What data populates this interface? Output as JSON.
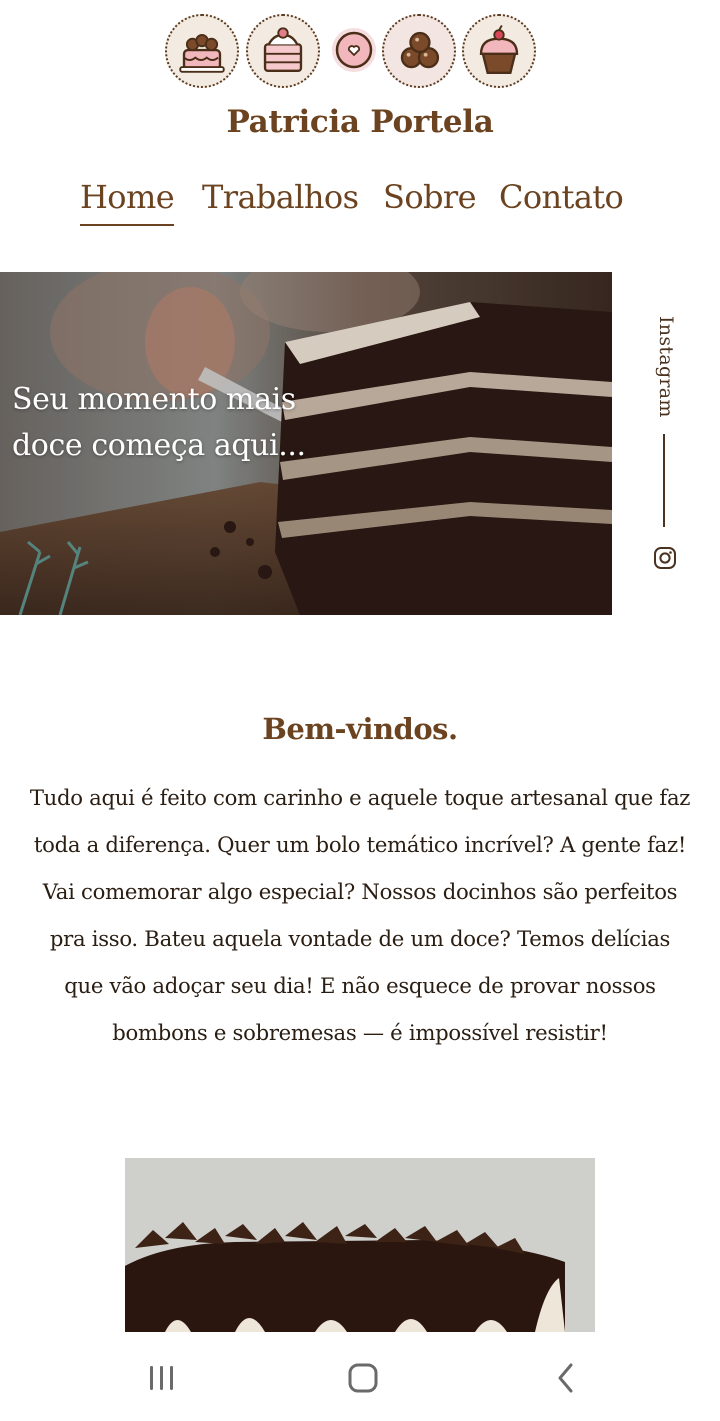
{
  "brand": {
    "name": "Patricia Portela"
  },
  "logo_badges": [
    {
      "icon": "layer-cake-icon"
    },
    {
      "icon": "cake-slice-icon"
    },
    {
      "icon": "donut-icon"
    },
    {
      "icon": "truffles-icon"
    },
    {
      "icon": "cupcake-icon"
    }
  ],
  "nav": {
    "items": [
      {
        "label": "Home",
        "active": true
      },
      {
        "label": "Trabalhos"
      },
      {
        "label": "Sobre"
      },
      {
        "label": "Contato"
      }
    ]
  },
  "hero": {
    "headline": "Seu momento mais doce começa aqui..."
  },
  "social": {
    "label": "Instagram",
    "icon": "instagram-icon"
  },
  "welcome": {
    "title": "Bem-vindos.",
    "body": "Tudo aqui é feito com carinho e aquele toque artesanal que faz toda a diferença. Quer um bolo temático incrível? A gente faz! Vai comemorar algo especial? Nossos docinhos são perfeitos pra isso. Bateu aquela vontade de um doce? Temos delícias que vão adoçar seu dia! E não esquece de provar nossos bombons e sobremesas — é impossível resistir!"
  },
  "system_nav": {
    "buttons": [
      "recent-apps-icon",
      "home-icon",
      "back-icon"
    ]
  },
  "colors": {
    "brand_brown": "#6b4320",
    "text_dark": "#2a1d12",
    "badge_bg": "#f3ebe1"
  }
}
